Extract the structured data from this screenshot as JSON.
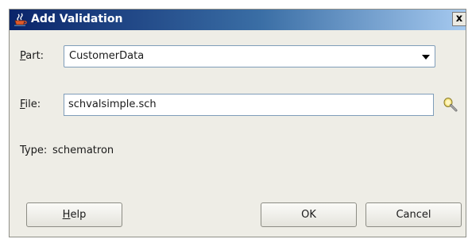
{
  "dialog": {
    "title": "Add Validation",
    "close_label": "x"
  },
  "form": {
    "part_label_key": "P",
    "part_label_rest": "art:",
    "part_value": "CustomerData",
    "file_label_key": "F",
    "file_label_rest": "ile:",
    "file_value": "schvalsimple.sch",
    "type_label": "Type:",
    "type_value": "schematron"
  },
  "buttons": {
    "help_key": "H",
    "help_rest": "elp",
    "ok": "OK",
    "cancel": "Cancel"
  },
  "icons": {
    "title": "java-cup-icon",
    "browse": "flashlight-search-icon",
    "dropdown": "chevron-down-icon"
  }
}
